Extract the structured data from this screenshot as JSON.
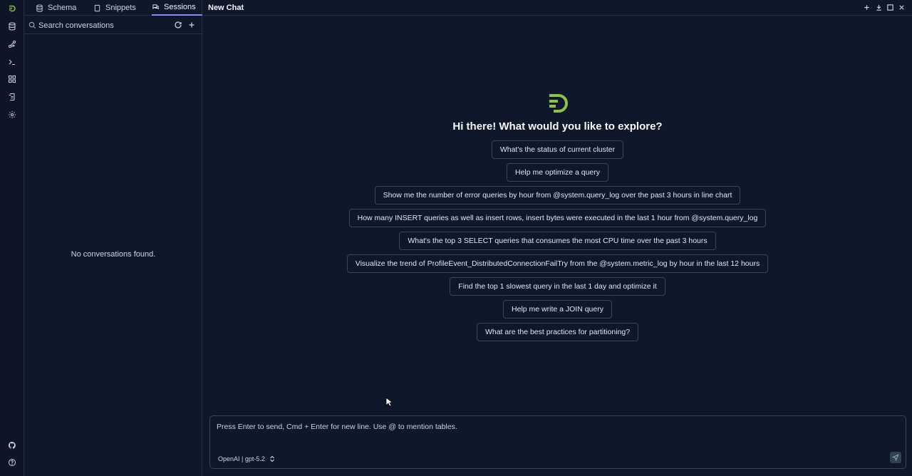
{
  "tabs": [
    {
      "label": "Schema",
      "icon": "database-icon"
    },
    {
      "label": "Snippets",
      "icon": "file-icon"
    },
    {
      "label": "Sessions",
      "icon": "chat-icon",
      "active": true
    }
  ],
  "search": {
    "placeholder": "Search conversations"
  },
  "sessions": {
    "empty_message": "No conversations found."
  },
  "main": {
    "title": "New Chat",
    "greeting": "Hi there! What would you like to explore?",
    "suggestions": [
      "What's the status of current cluster",
      "Help me optimize a query",
      "Show me the number of error queries by hour from @system.query_log over the past 3 hours in line chart",
      "How many INSERT queries as well as insert rows, insert bytes were executed in the last 1 hour from @system.query_log",
      "What's the top 3 SELECT queries that consumes the most CPU time over the past 3 hours",
      "Visualize the trend of ProfileEvent_DistributedConnectionFailTry from the @system.metric_log by hour in the last 12 hours",
      "Find the top 1 slowest query in the last 1 day and optimize it",
      "Help me write a JOIN query",
      "What are the best practices for partitioning?"
    ]
  },
  "composer": {
    "placeholder": "Press Enter to send, Cmd + Enter for new line. Use @ to mention tables.",
    "model": "OpenAI | gpt-5.2"
  },
  "colors": {
    "background": "#0f172a",
    "border": "#243044",
    "accent": "#818cf8",
    "logo": "#8bc34a"
  }
}
